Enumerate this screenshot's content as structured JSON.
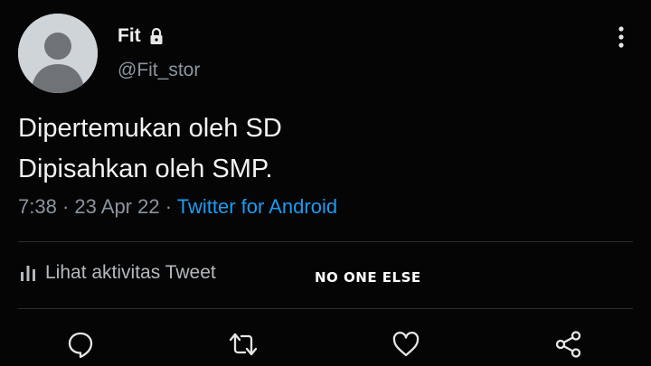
{
  "author": {
    "display_name": "Fit",
    "handle": "@Fit_stor",
    "avatar_icon": "default-avatar-icon",
    "protected_icon": "lock-icon"
  },
  "tweet": {
    "lines": [
      "Dipertemukan oleh SD",
      "Dipisahkan oleh SMP."
    ],
    "time": "7:38",
    "date": "23 Apr 22",
    "separator": "·",
    "source": "Twitter for Android"
  },
  "activity": {
    "label": "Lihat aktivitas Tweet",
    "icon": "bar-chart-icon"
  },
  "overlay": {
    "text": "NO ONE ELSE"
  },
  "actions": [
    {
      "name": "reply",
      "icon": "reply-icon"
    },
    {
      "name": "retweet",
      "icon": "retweet-icon"
    },
    {
      "name": "like",
      "icon": "heart-icon"
    },
    {
      "name": "share",
      "icon": "share-icon"
    }
  ],
  "colors": {
    "background": "#050505",
    "text": "#f2f2f2",
    "muted": "#8b949e",
    "link": "#1d9bf0",
    "divider": "#2a2e33"
  }
}
